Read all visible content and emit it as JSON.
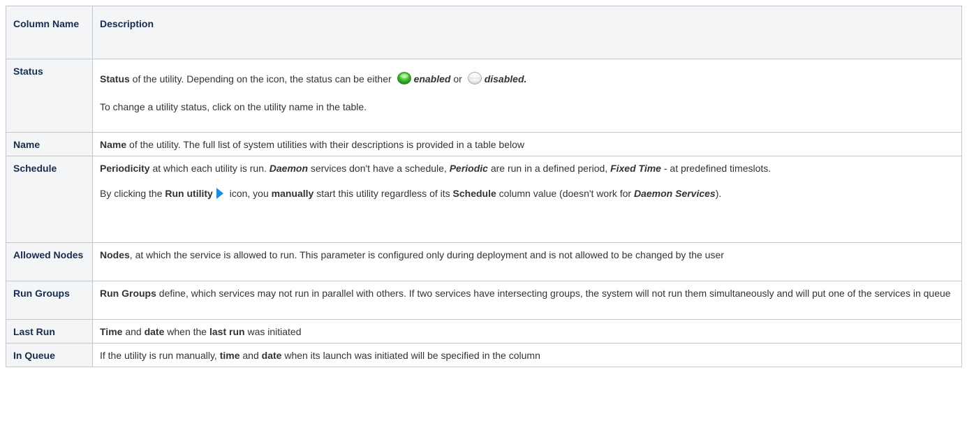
{
  "header": {
    "col1": "Column Name",
    "col2": "Description"
  },
  "rows": {
    "status": {
      "name": "Status",
      "p1_b1": "Status",
      "p1_t1": " of the utility. Depending on the icon, the status can be either ",
      "enabled": "enabled",
      "p1_t2": " or ",
      "disabled": "disabled.",
      "p2": "To change a utility status, click on the utility name in the table."
    },
    "name": {
      "name": "Name",
      "b1": "Name",
      "t1": " of the utility. The full list of system utilities with their descriptions is provided in a table below"
    },
    "schedule": {
      "name": "Schedule",
      "b1": "Periodicity",
      "t1": " at which each utility is run. ",
      "bi1": "Daemon",
      "t2": " services don't have a schedule, ",
      "bi2": "Periodic",
      "t3": " are run in a defined period, ",
      "bi3": "Fixed Time",
      "t4": " - at predefined timeslots.",
      "p2_t1": "By clicking the ",
      "p2_b1": "Run utility",
      "p2_t2": " icon, you ",
      "p2_b2": "manually",
      "p2_t3": " start this utility regardless of its ",
      "p2_b3": "Schedule",
      "p2_t4": " column value (doesn't work for ",
      "p2_bi1": "Daemon Services",
      "p2_t5": ")."
    },
    "allowed_nodes": {
      "name": "Allowed Nodes",
      "b1": "Nodes",
      "t1": ", at which the service is allowed to run. This parameter is configured only during deployment and is not allowed to be changed by the user"
    },
    "run_groups": {
      "name": "Run Groups",
      "b1": "Run Groups",
      "t1": " define, which services may not run in parallel with others. If two services have intersecting groups, the system will not run them simultaneously and will put one of the services in queue"
    },
    "last_run": {
      "name": "Last Run",
      "b1": "Time",
      "t1": " and ",
      "b2": "date",
      "t2": " when the ",
      "b3": "last run",
      "t3": " was initiated"
    },
    "in_queue": {
      "name": "In Queue",
      "t1": "If the utility is run manually, ",
      "b1": "time",
      "t2": " and ",
      "b2": "date",
      "t3": " when its launch was initiated will be specified in the column"
    }
  },
  "icons": {
    "enabled": "green-dot-icon",
    "disabled": "gray-dot-icon",
    "run": "play-icon"
  },
  "colors": {
    "border": "#c1c7d0",
    "header_bg": "#f4f5f7",
    "enabled_green": "#2fb52c",
    "run_blue": "#1b8ce0"
  }
}
